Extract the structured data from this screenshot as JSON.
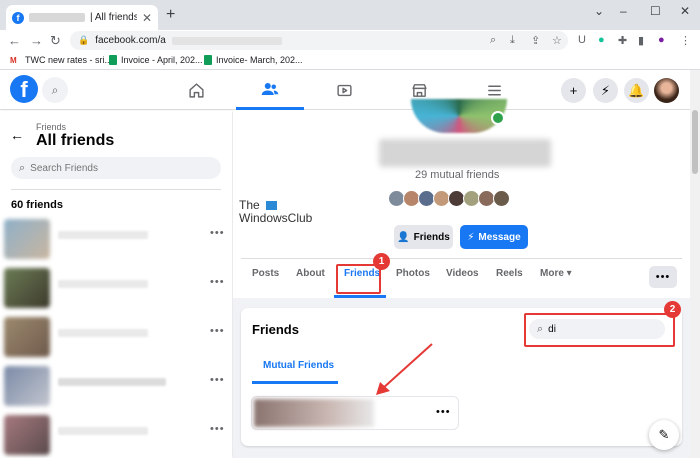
{
  "browser": {
    "tab_title": "| All friends | Fa",
    "tab_close": "✕",
    "new_tab": "+",
    "url": "facebook.com/a",
    "controls": {
      "minimize": "–",
      "maximize": "☐",
      "close": "✕"
    },
    "bookmarks": [
      {
        "label": "TWC new rates - sri..."
      },
      {
        "label": "Invoice - April, 202..."
      },
      {
        "label": "Invoice- March, 202..."
      }
    ]
  },
  "facebook": {
    "logo": "f",
    "nav": [
      "home-icon",
      "friends-icon",
      "watch-icon",
      "marketplace-icon",
      "menu-icon"
    ],
    "active_nav": "friends-icon"
  },
  "sidebar": {
    "breadcrumb": "Friends",
    "title": "All friends",
    "search_placeholder": "Search Friends",
    "friend_count": "60 friends"
  },
  "profile": {
    "mutual_friends": "29 mutual friends",
    "friends_button": "Friends",
    "message_button": "Message",
    "tabs": [
      "Posts",
      "About",
      "Friends",
      "Photos",
      "Videos",
      "Reels",
      "More ▾"
    ],
    "active_tab": "Friends",
    "watermark_line1": "The",
    "watermark_line2": "WindowsClub"
  },
  "friends_section": {
    "title": "Friends",
    "search_value": "di",
    "tab": "Mutual Friends"
  },
  "annotations": {
    "badge_1": "1",
    "badge_2": "2",
    "color": "#e53935"
  },
  "colors": {
    "fb_blue": "#1877f2",
    "online_green": "#31a24c"
  }
}
